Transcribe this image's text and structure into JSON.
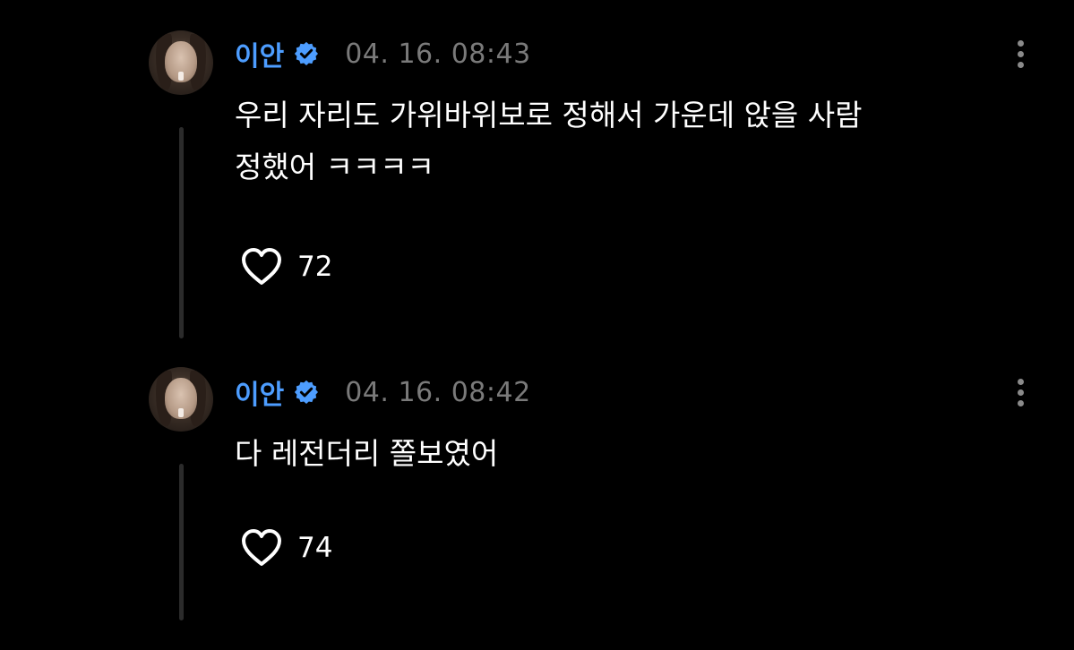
{
  "comments": [
    {
      "username": "이안",
      "timestamp": "04. 16. 08:43",
      "text": "우리 자리도 가위바위보로 정해서 가운데 앉을 사람\n정했어 ㅋㅋㅋㅋ",
      "likes": "72"
    },
    {
      "username": "이안",
      "timestamp": "04. 16. 08:42",
      "text": "다 레전더리 쫄보였어",
      "likes": "74"
    }
  ],
  "colors": {
    "background": "#000000",
    "username": "#4d9dff",
    "verified_badge": "#4d9dff",
    "timestamp": "#7a7a7a",
    "thread_line": "#2b2b2b"
  },
  "icons": {
    "verified": "verified-badge-icon",
    "like": "heart-outline-icon",
    "more": "more-vertical-icon"
  }
}
